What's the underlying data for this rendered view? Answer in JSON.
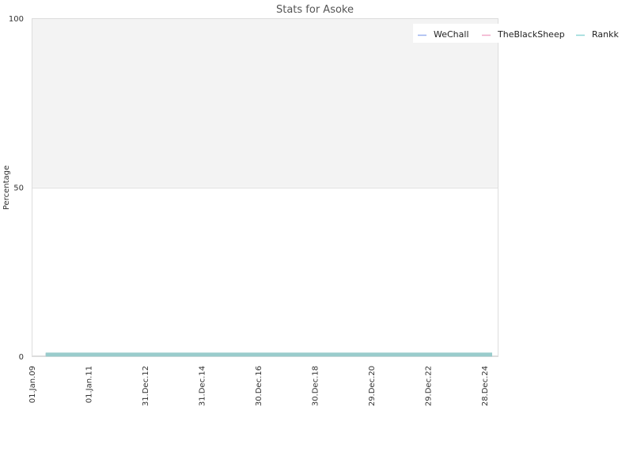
{
  "chart_data": {
    "type": "line",
    "title": "Stats for Asoke",
    "xlabel": "",
    "ylabel": "Percentage",
    "ylim": [
      0,
      100
    ],
    "y_ticks": [
      0,
      50,
      100
    ],
    "x_range": [
      "2009-01-01",
      "2025-07-01"
    ],
    "x_ticks": [
      {
        "date": "2009-01-01",
        "label": "01.Jan.09"
      },
      {
        "date": "2011-01-01",
        "label": "01.Jan.11"
      },
      {
        "date": "2012-12-31",
        "label": "31.Dec.12"
      },
      {
        "date": "2014-12-31",
        "label": "31.Dec.14"
      },
      {
        "date": "2016-12-30",
        "label": "30.Dec.16"
      },
      {
        "date": "2018-12-30",
        "label": "30.Dec.18"
      },
      {
        "date": "2020-12-29",
        "label": "29.Dec.20"
      },
      {
        "date": "2022-12-29",
        "label": "29.Dec.22"
      },
      {
        "date": "2024-12-28",
        "label": "28.Dec.24"
      }
    ],
    "grid": true,
    "legend_position": "top-right",
    "series": [
      {
        "name": "WeChall",
        "color": "#9bb0ee",
        "x": [
          "2009-07-01",
          "2025-04-10"
        ],
        "values": [
          0.5,
          0.5
        ]
      },
      {
        "name": "TheBlackSheep",
        "color": "#f0a8c8",
        "x": [
          "2009-07-01",
          "2025-04-10"
        ],
        "values": [
          0.5,
          0.5
        ]
      },
      {
        "name": "Rankk",
        "color": "#8fd6d6",
        "x": [
          "2009-07-01",
          "2025-04-10"
        ],
        "values": [
          0.5,
          0.5
        ]
      }
    ],
    "colors": {
      "plot_background_upper": "#f3f3f3",
      "plot_background_lower": "#ffffff",
      "grid": "#dddddd",
      "axis_text": "#333333",
      "title_text": "#555555",
      "thick_line": "#99cccc"
    }
  }
}
